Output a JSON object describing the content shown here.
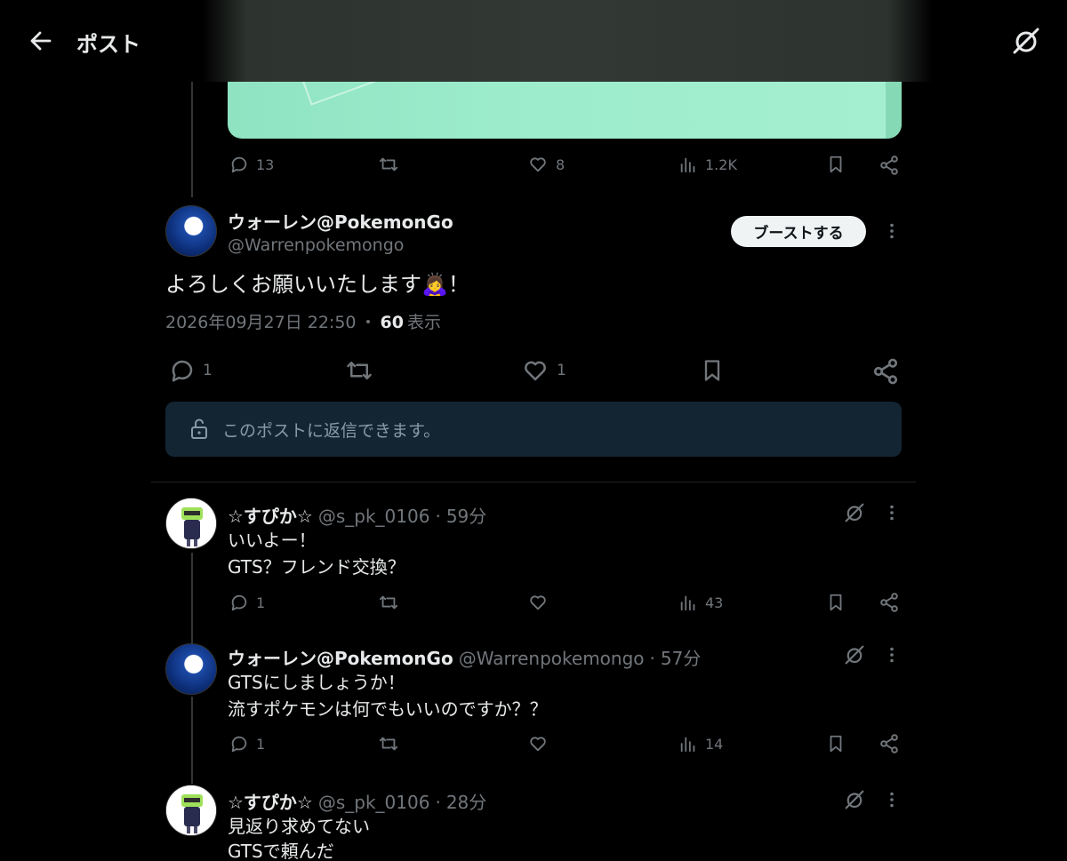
{
  "header": {
    "title": "ポスト"
  },
  "prev_post_actions": {
    "reply_count": "13",
    "like_count": "8",
    "views_count": "1.2K"
  },
  "main_post": {
    "display_name": "ウォーレン@PokemonGo",
    "handle": "@Warrenpokemongo",
    "boost_label": "ブーストする",
    "text": "よろしくお願いいたします🙇‍♀️！",
    "timestamp": "2026年09月27日 22:50",
    "separator": "・",
    "views_number": "60",
    "views_label": "表示",
    "reply_count": "1",
    "like_count": "1"
  },
  "reply_restriction": {
    "text": "このポストに返信できます。"
  },
  "replies": [
    {
      "display_name": "☆すぴか☆",
      "handle": "@s_pk_0106",
      "time": "59分",
      "lines": [
        "いいよー！",
        "GTS？フレンド交換？"
      ],
      "reply_count": "1",
      "views_count": "43"
    },
    {
      "display_name": "ウォーレン@PokemonGo",
      "handle": "@Warrenpokemongo",
      "time": "57分",
      "lines": [
        "GTSにしましょうか！",
        "流すポケモンは何でもいいのですか？？"
      ],
      "reply_count": "1",
      "views_count": "14"
    },
    {
      "display_name": "☆すぴか☆",
      "handle": "@s_pk_0106",
      "time": "28分",
      "lines": [
        "見返り求めてない",
        "GTSで頼んだ"
      ]
    }
  ],
  "dot": "·",
  "colors": {
    "background": "#000000",
    "text_primary": "#e7e9ea",
    "text_secondary": "#71767b",
    "reply_box": "#132533",
    "accent_media": "#9ceccc"
  },
  "icons": [
    "back-arrow-icon",
    "grok-icon",
    "reply-icon",
    "repost-icon",
    "like-icon",
    "views-icon",
    "bookmark-icon",
    "share-icon",
    "more-icon",
    "lock-icon"
  ]
}
